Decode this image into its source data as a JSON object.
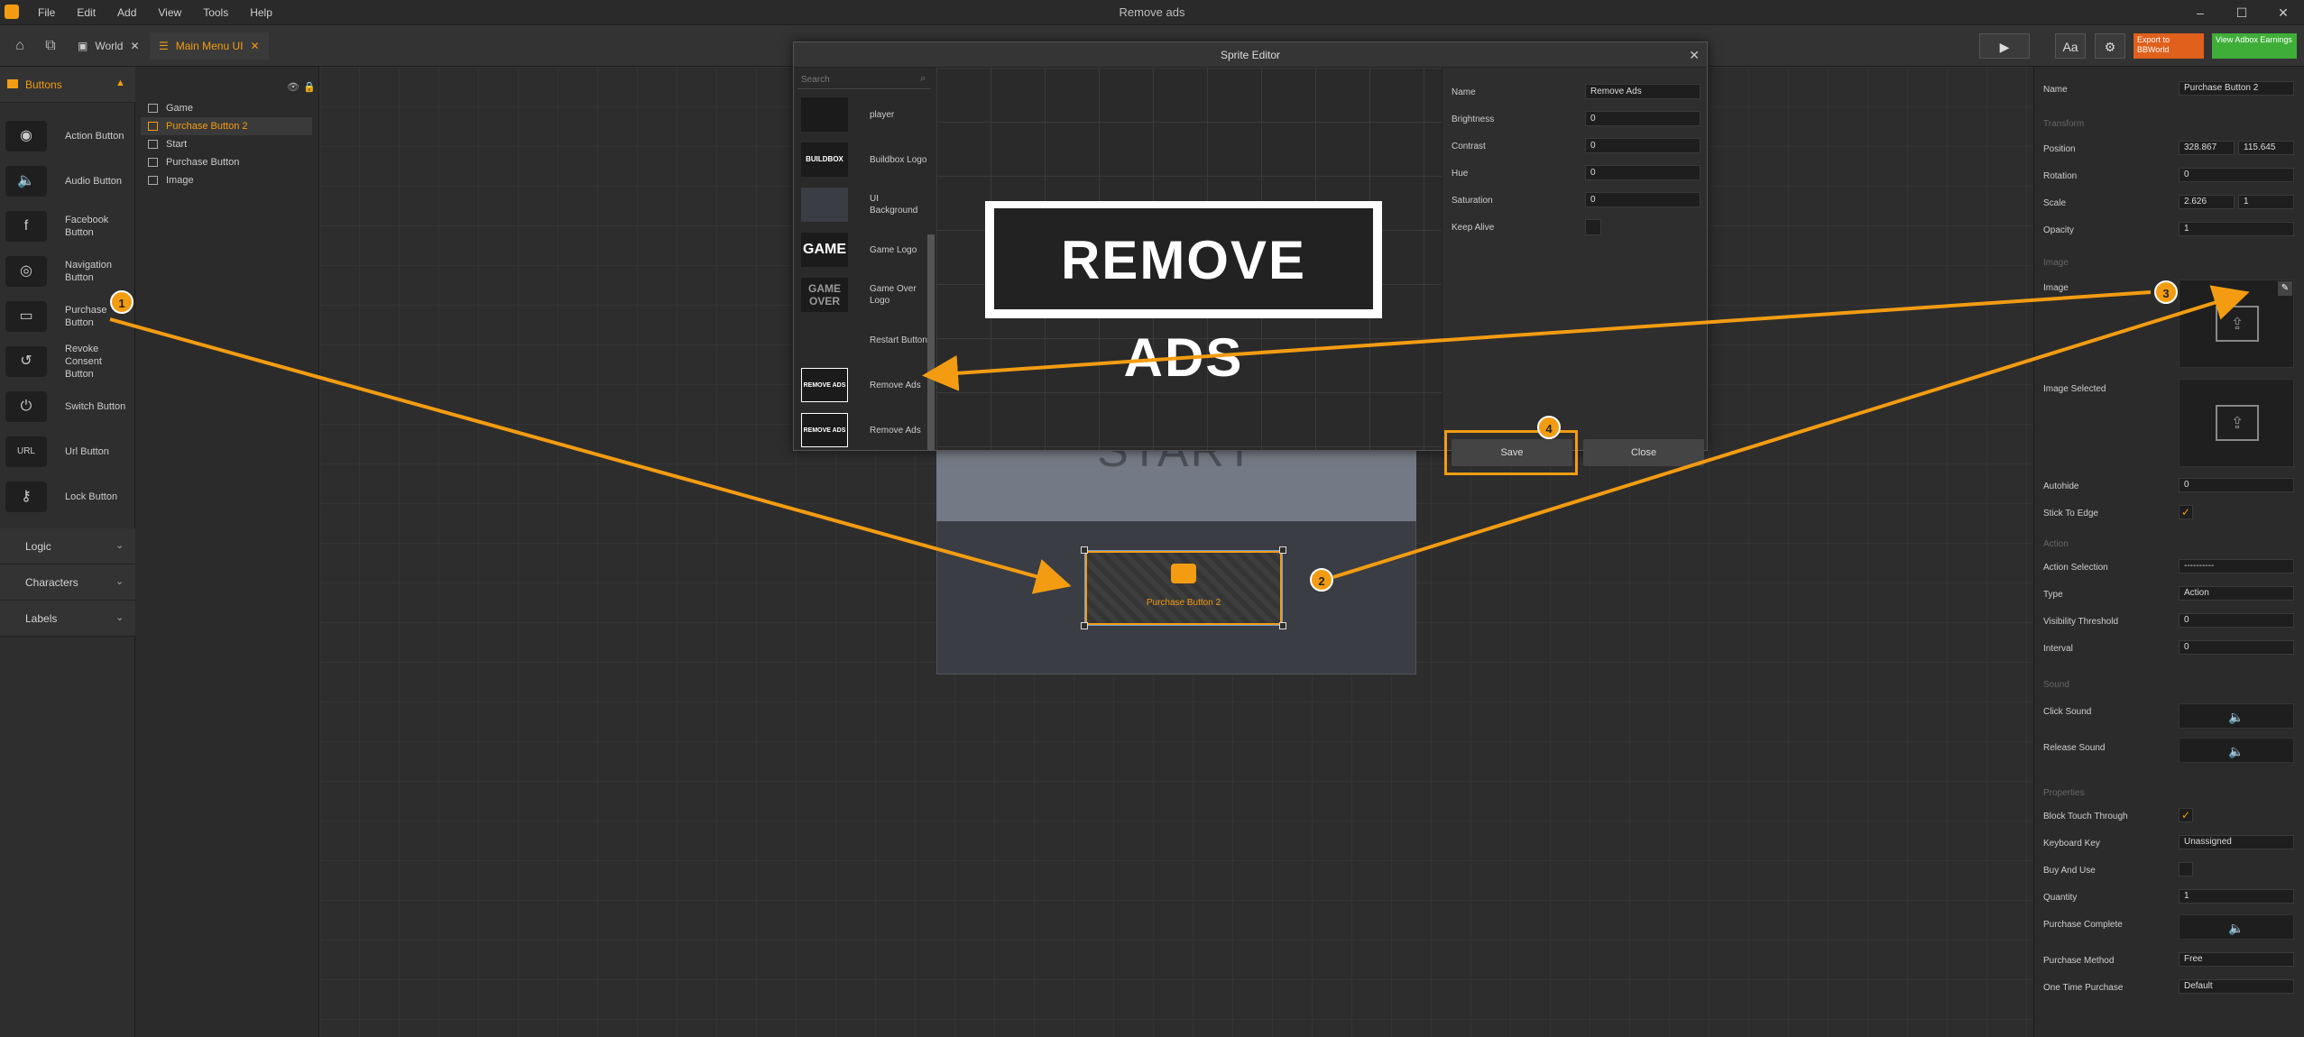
{
  "app": {
    "title": "Remove ads",
    "menu": [
      "File",
      "Edit",
      "Add",
      "View",
      "Tools",
      "Help"
    ]
  },
  "tabs": [
    {
      "label": "World"
    },
    {
      "label": "Main Menu UI"
    }
  ],
  "toolbar": {
    "export_label": "Export to BBWorld",
    "adbox_label": "View Adbox Earnings",
    "font_label": "Aa"
  },
  "left": {
    "section": "Buttons",
    "buttons": [
      "Action Button",
      "Audio Button",
      "Facebook Button",
      "Navigation Button",
      "Purchase Button",
      "Revoke Consent Button",
      "Switch Button",
      "Url Button",
      "Lock Button"
    ],
    "groups": [
      "Logic",
      "Characters",
      "Labels"
    ]
  },
  "tree": [
    "Game",
    "Purchase Button 2",
    "Start",
    "Purchase Button",
    "Image"
  ],
  "canvas": {
    "start_text": "START",
    "purchase_label": "Purchase Button 2"
  },
  "sprite_editor": {
    "title": "Sprite Editor",
    "search_placeholder": "Search",
    "items": [
      {
        "thumb": "",
        "name": "player"
      },
      {
        "thumb": "BUILDBOX",
        "name": "Buildbox Logo"
      },
      {
        "thumb": "",
        "name": "UI Background"
      },
      {
        "thumb": "GAME",
        "name": "Game Logo"
      },
      {
        "thumb": "GAME OVER",
        "name": "Game Over Logo"
      },
      {
        "thumb": "",
        "name": "Restart Button"
      },
      {
        "thumb": "REMOVE ADS",
        "name": "Remove Ads"
      },
      {
        "thumb": "REMOVE ADS",
        "name": "Remove Ads"
      }
    ],
    "preview_text": "REMOVE ADS",
    "props": [
      {
        "label": "Name",
        "value": "Remove Ads"
      },
      {
        "label": "Brightness",
        "value": "0"
      },
      {
        "label": "Contrast",
        "value": "0"
      },
      {
        "label": "Hue",
        "value": "0"
      },
      {
        "label": "Saturation",
        "value": "0"
      }
    ],
    "keep_alive_label": "Keep Alive",
    "save_label": "Save",
    "close_label": "Close"
  },
  "right": {
    "name_label": "Name",
    "name_value": "Purchase Button 2",
    "transform": "Transform",
    "position_label": "Position",
    "pos_x": "328.867",
    "pos_y": "115.645",
    "rotation_label": "Rotation",
    "rotation": "0",
    "scale_label": "Scale",
    "scale_x": "2.626",
    "scale_y": "1",
    "opacity_label": "Opacity",
    "opacity": "1",
    "image_group": "Image",
    "image_label": "Image",
    "image_selected_label": "Image Selected",
    "autohide_label": "Autohide",
    "autohide": "0",
    "stick_label": "Stick To Edge",
    "action_group": "Action",
    "action_selection_label": "Action Selection",
    "action_selection": "----------",
    "type_label": "Type",
    "type_value": "Action",
    "visibility_label": "Visibility Threshold",
    "visibility": "0",
    "interval_label": "Interval",
    "interval": "0",
    "sound_group": "Sound",
    "click_sound": "Click Sound",
    "release_sound": "Release Sound",
    "properties_group": "Properties",
    "block_touch": "Block Touch Through",
    "keyboard_key_label": "Keyboard Key",
    "keyboard_key": "Unassigned",
    "buy_and_use": "Buy And Use",
    "quantity_label": "Quantity",
    "quantity": "1",
    "purchase_complete": "Purchase Complete",
    "purchase_method_label": "Purchase Method",
    "purchase_method": "Free",
    "one_time_label": "One Time Purchase",
    "one_time": "Default"
  },
  "callouts": [
    "1",
    "2",
    "3",
    "4"
  ],
  "colors": {
    "accent": "#f39c12",
    "bg": "#2b2b2b"
  }
}
